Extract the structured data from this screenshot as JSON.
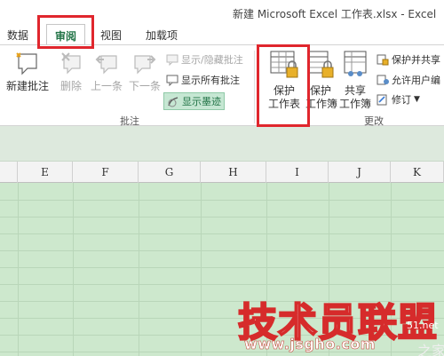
{
  "window": {
    "title": "新建 Microsoft Excel 工作表.xlsx - Excel"
  },
  "tabs": [
    {
      "label": "数据"
    },
    {
      "label": "审阅",
      "active": true
    },
    {
      "label": "视图"
    },
    {
      "label": "加载项"
    }
  ],
  "ribbon": {
    "comments_group": {
      "label": "批注",
      "new_comment": "新建批注",
      "delete": "删除",
      "previous": "上一条",
      "next": "下一条",
      "show_hide_comment": "显示/隐藏批注",
      "show_all_comments": "显示所有批注",
      "show_ink": "显示墨迹"
    },
    "changes_group": {
      "label": "更改",
      "protect_sheet_line1": "保护",
      "protect_sheet_line2": "工作表",
      "protect_workbook_line1": "保护",
      "protect_workbook_line2": "工作簿",
      "share_workbook_line1": "共享",
      "share_workbook_line2": "工作簿",
      "protect_and_share": "保护并共享",
      "allow_users_edit": "允许用户编",
      "track_changes": "修订"
    }
  },
  "columns": [
    "E",
    "F",
    "G",
    "H",
    "I",
    "J",
    "K"
  ],
  "colors": {
    "accent": "#217346",
    "highlight": "#e0262d",
    "grid_fill": "#cde8cd"
  },
  "watermark": {
    "text": "技术员联盟",
    "url": "www.jsgho.com",
    "side1": "51.net",
    "side2": "之家"
  }
}
